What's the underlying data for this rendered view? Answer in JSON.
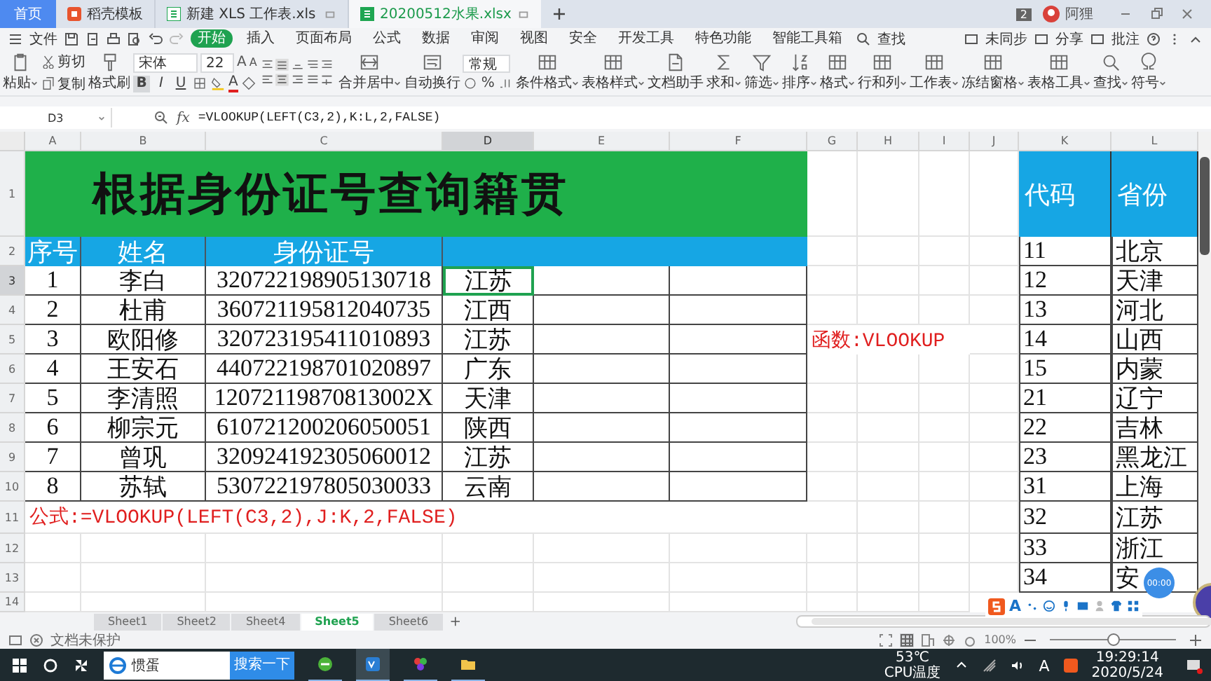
{
  "tabs": [
    {
      "label": "首页",
      "kind": "home",
      "selected": false
    },
    {
      "label": "稻壳模板",
      "kind": "docer",
      "selected": false
    },
    {
      "label": "新建 XLS 工作表.xls",
      "kind": "sheet",
      "selected": false
    },
    {
      "label": "20200512水果.xlsx",
      "kind": "sheet",
      "selected": true
    }
  ],
  "account": {
    "badge": "2",
    "user": "阿狸"
  },
  "menu": {
    "file": "文件",
    "items": [
      {
        "label": "开始",
        "selected": true
      },
      {
        "label": "插入",
        "selected": false
      },
      {
        "label": "页面布局",
        "selected": false
      },
      {
        "label": "公式",
        "selected": false
      },
      {
        "label": "数据",
        "selected": false
      },
      {
        "label": "审阅",
        "selected": false
      },
      {
        "label": "视图",
        "selected": false
      },
      {
        "label": "安全",
        "selected": false
      },
      {
        "label": "开发工具",
        "selected": false
      },
      {
        "label": "特色功能",
        "selected": false
      },
      {
        "label": "智能工具箱",
        "selected": false
      }
    ],
    "search": "查找",
    "right": [
      "未同步",
      "分享",
      "批注"
    ]
  },
  "ribbon": [
    {
      "kind": "large",
      "label": "粘贴",
      "dropdown": true
    },
    {
      "kind": "stack",
      "items": [
        "剪切",
        "复制"
      ]
    },
    {
      "kind": "large",
      "label": "格式刷",
      "dropdown": false
    },
    {
      "kind": "font",
      "font": "宋体",
      "size": "22",
      "size_buttons": [
        "A",
        "A"
      ],
      "buttons": [
        {
          "label": "B",
          "selected": true
        },
        {
          "label": "I",
          "selected": false
        },
        {
          "label": "U",
          "selected": false
        }
      ],
      "font_color": "A"
    },
    {
      "kind": "align"
    },
    {
      "kind": "large",
      "label": "合并居中",
      "dropdown": true
    },
    {
      "kind": "large",
      "label": "自动换行",
      "dropdown": false
    },
    {
      "kind": "number",
      "format": "常规",
      "symbol": "%"
    },
    {
      "kind": "large",
      "label": "条件格式",
      "dropdown": true
    },
    {
      "kind": "large",
      "label": "表格样式",
      "dropdown": true
    },
    {
      "kind": "large",
      "label": "文档助手",
      "dropdown": false
    },
    {
      "kind": "large",
      "label": "求和",
      "dropdown": true
    },
    {
      "kind": "large",
      "label": "筛选",
      "dropdown": true
    },
    {
      "kind": "large",
      "label": "排序",
      "dropdown": true
    },
    {
      "kind": "large",
      "label": "格式",
      "dropdown": true
    },
    {
      "kind": "large",
      "label": "行和列",
      "dropdown": true
    },
    {
      "kind": "large",
      "label": "工作表",
      "dropdown": true
    },
    {
      "kind": "large",
      "label": "冻结窗格",
      "dropdown": true
    },
    {
      "kind": "large",
      "label": "表格工具",
      "dropdown": true
    },
    {
      "kind": "large",
      "label": "查找",
      "dropdown": true
    },
    {
      "kind": "large",
      "label": "符号",
      "dropdown": true
    }
  ],
  "formula_bar": {
    "name_box": "D3",
    "fx": "fx",
    "formula": "=VLOOKUP(LEFT(C3,2),K:L,2,FALSE)"
  },
  "sheet": {
    "columns": [
      {
        "label": "A",
        "selected": false
      },
      {
        "label": "B",
        "selected": false
      },
      {
        "label": "C",
        "selected": false
      },
      {
        "label": "D",
        "selected": true
      },
      {
        "label": "E",
        "selected": false
      },
      {
        "label": "F",
        "selected": false
      },
      {
        "label": "G",
        "selected": false
      },
      {
        "label": "H",
        "selected": false
      },
      {
        "label": "I",
        "selected": false
      },
      {
        "label": "J",
        "selected": false
      },
      {
        "label": "K",
        "selected": false
      },
      {
        "label": "L",
        "selected": false
      }
    ],
    "rows": [
      {
        "label": "1",
        "selected": false
      },
      {
        "label": "2",
        "selected": false
      },
      {
        "label": "3",
        "selected": true
      },
      {
        "label": "4",
        "selected": false
      },
      {
        "label": "5",
        "selected": false
      },
      {
        "label": "6",
        "selected": false
      },
      {
        "label": "7",
        "selected": false
      },
      {
        "label": "8",
        "selected": false
      },
      {
        "label": "9",
        "selected": false
      },
      {
        "label": "10",
        "selected": false
      },
      {
        "label": "11",
        "selected": false
      },
      {
        "label": "12",
        "selected": false
      },
      {
        "label": "13",
        "selected": false
      },
      {
        "label": "14",
        "selected": false
      }
    ],
    "title": "根据身份证号查询籍贯",
    "headers": [
      "序号",
      "姓名",
      "身份证号"
    ],
    "records": [
      {
        "no": "1",
        "name": "李白",
        "id": "320722198905130718",
        "province": "江苏",
        "selected": true
      },
      {
        "no": "2",
        "name": "杜甫",
        "id": "360721195812040735",
        "province": "江西",
        "selected": false
      },
      {
        "no": "3",
        "name": "欧阳修",
        "id": "320723195411010893",
        "province": "江苏",
        "selected": false
      },
      {
        "no": "4",
        "name": "王安石",
        "id": "440722198701020897",
        "province": "广东",
        "selected": false
      },
      {
        "no": "5",
        "name": "李清照",
        "id": "12072119870813002X",
        "province": "天津",
        "selected": false
      },
      {
        "no": "6",
        "name": "柳宗元",
        "id": "610721200206050051",
        "province": "陕西",
        "selected": false
      },
      {
        "no": "7",
        "name": "曾巩",
        "id": "320924192305060012",
        "province": "江苏",
        "selected": false
      },
      {
        "no": "8",
        "name": "苏轼",
        "id": "530722197805030033",
        "province": "云南",
        "selected": false
      }
    ],
    "formula_note": "公式:=VLOOKUP(LEFT(C3,2),J:K,2,FALSE)",
    "function_note": "函数:VLOOKUP",
    "lookup_headers": [
      "代码",
      "省份"
    ],
    "lookup": [
      {
        "code": "11",
        "province": "北京"
      },
      {
        "code": "12",
        "province": "天津"
      },
      {
        "code": "13",
        "province": "河北"
      },
      {
        "code": "14",
        "province": "山西"
      },
      {
        "code": "15",
        "province": "内蒙"
      },
      {
        "code": "21",
        "province": "辽宁"
      },
      {
        "code": "22",
        "province": "吉林"
      },
      {
        "code": "23",
        "province": "黑龙江"
      },
      {
        "code": "31",
        "province": "上海"
      },
      {
        "code": "32",
        "province": "江苏"
      },
      {
        "code": "33",
        "province": "浙江"
      },
      {
        "code": "34",
        "province": "安"
      }
    ]
  },
  "timer_bubble": "00:00",
  "sheet_tabs": [
    {
      "label": "Sheet1",
      "selected": false
    },
    {
      "label": "Sheet2",
      "selected": false
    },
    {
      "label": "Sheet4",
      "selected": false
    },
    {
      "label": "Sheet5",
      "selected": true
    },
    {
      "label": "Sheet6",
      "selected": false
    }
  ],
  "status_bar": {
    "protection": "文档未保护",
    "zoom": "100%",
    "zoom_slider": {
      "level": 0.5
    }
  },
  "ime_toolbar": {
    "label": "A"
  },
  "taskbar": {
    "search_text": "惯蛋",
    "search_button": "搜索一下",
    "temperature": "53℃",
    "temperature_label": "CPU温度",
    "ime": "A",
    "time": "19:29:14",
    "date": "2020/5/24"
  }
}
